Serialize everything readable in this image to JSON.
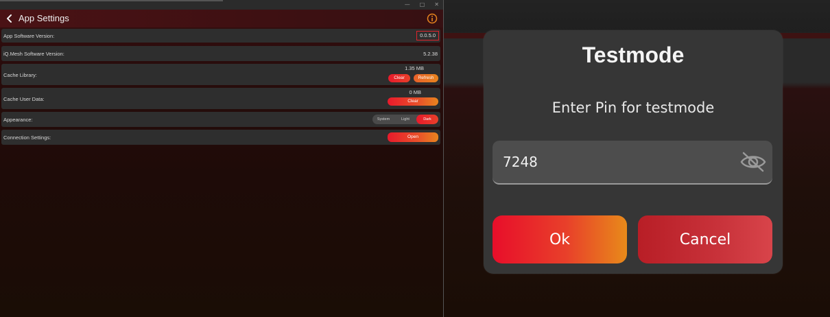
{
  "left": {
    "window_controls": {
      "minimize": "—",
      "maximize": "□",
      "close": "✕"
    },
    "header": {
      "title": "App Settings",
      "back_icon": "chevron-left-icon",
      "info_icon": "info-icon"
    },
    "settings": {
      "app_version": {
        "label": "App Software Version:",
        "value": "0.0.5.0"
      },
      "mesh_version": {
        "label": "iQ.Mesh Software Version:",
        "value": "5.2.38"
      },
      "cache_library": {
        "label": "Cache Library:",
        "size": "1.35 MB",
        "clear_label": "Clear",
        "refresh_label": "Refresh"
      },
      "cache_user": {
        "label": "Cache User Data:",
        "size": "0 MB",
        "clear_label": "Clear"
      },
      "appearance": {
        "label": "Appearance:",
        "options": [
          "System",
          "Light",
          "Dark"
        ],
        "selected": "Dark"
      },
      "connection": {
        "label": "Connection Settings:",
        "open_label": "Open"
      }
    },
    "colors": {
      "accent_red": "#e81a2b",
      "accent_orange": "#e8851e",
      "highlight_box": "#e0242c"
    }
  },
  "dialog": {
    "title": "Testmode",
    "message": "Enter Pin for testmode",
    "pin_value": "7248",
    "eye_icon": "eye-off-icon",
    "ok_label": "Ok",
    "cancel_label": "Cancel"
  }
}
